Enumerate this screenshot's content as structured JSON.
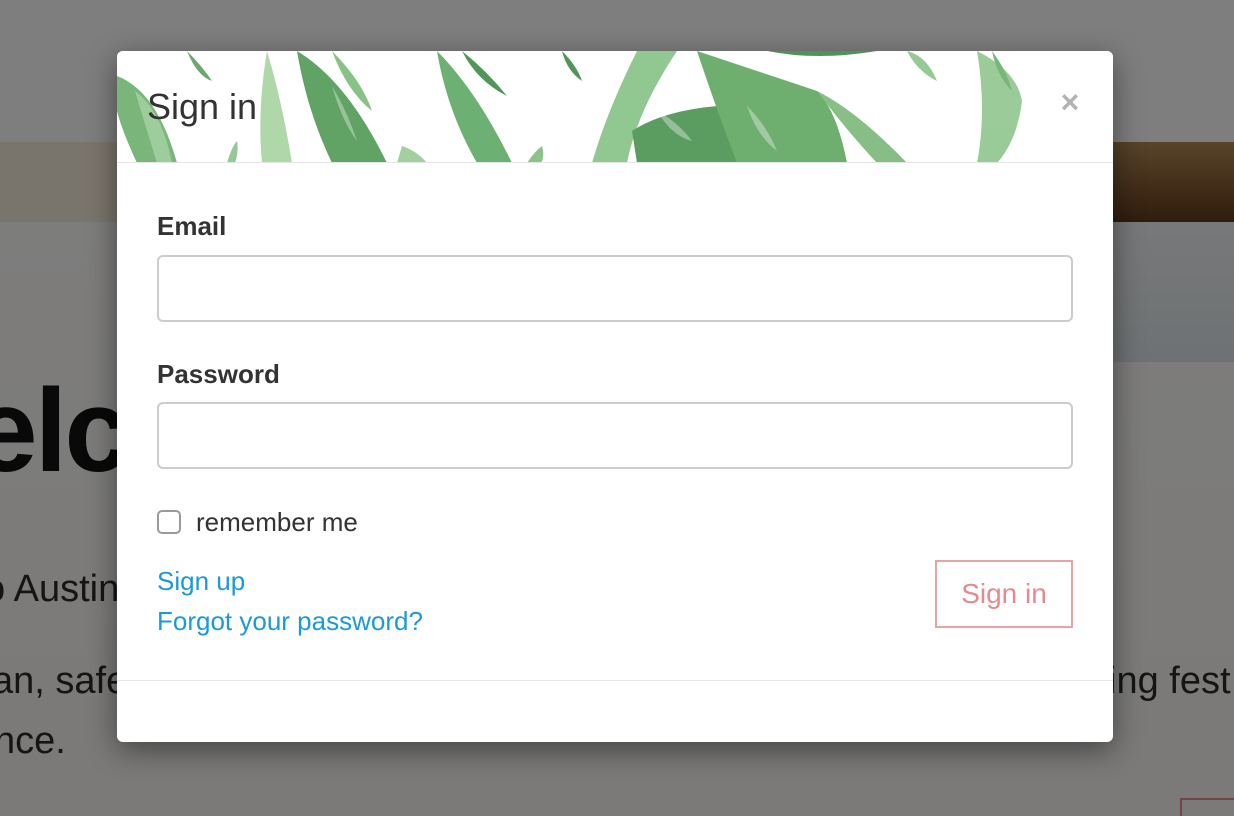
{
  "background": {
    "hero_title": "elc",
    "text_line_1": "o Austin",
    "text_line_2": "an, safe",
    "text_line_3": "ing fest",
    "text_line_4": "nce."
  },
  "modal": {
    "title": "Sign in",
    "close_symbol": "×",
    "email_label": "Email",
    "email_value": "",
    "email_placeholder": "",
    "password_label": "Password",
    "password_value": "",
    "password_placeholder": "",
    "remember_label": "remember me",
    "remember_checked": false,
    "signup_link": "Sign up",
    "forgot_link": "Forgot your password?",
    "submit_label": "Sign in"
  },
  "icons": {
    "close": "close-icon",
    "checkbox": "checkbox-unchecked-icon"
  },
  "colors": {
    "link": "#1a9ad6",
    "submit_border": "#e9a3a8",
    "submit_text": "#e58a92",
    "leaf_green": "#5fa65f"
  }
}
